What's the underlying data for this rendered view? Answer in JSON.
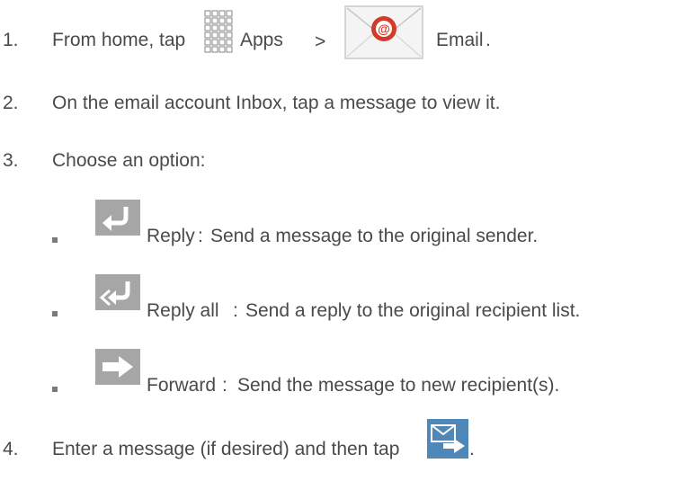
{
  "steps": [
    {
      "number": "1.",
      "parts": [
        "From home, tap",
        "Apps",
        ">",
        "Email",
        "."
      ]
    },
    {
      "number": "2.",
      "text": "On the email account Inbox, tap a message to view it."
    },
    {
      "number": "3.",
      "text": "Choose an option:"
    },
    {
      "number": "4.",
      "text": "Enter a message (if desired) and then tap",
      "end": "."
    }
  ],
  "options": [
    {
      "name": "Reply",
      "sep": ":",
      "desc": "Send a message to the original sender.",
      "icon": "reply-icon"
    },
    {
      "name": "Reply all",
      "sep": ":",
      "desc": "Send a reply to the original recipient list.",
      "icon": "reply-all-icon"
    },
    {
      "name": "Forward",
      "sep": ":",
      "desc": "Send  the message to new recipient(s).",
      "icon": "forward-icon"
    }
  ],
  "icons": {
    "apps": "apps-grid-icon",
    "email": "email-envelope-icon",
    "send": "send-icon"
  },
  "colors": {
    "text": "#4a4a4a",
    "icon_gray": "#a6a6a6",
    "email_red": "#d23a2a"
  }
}
